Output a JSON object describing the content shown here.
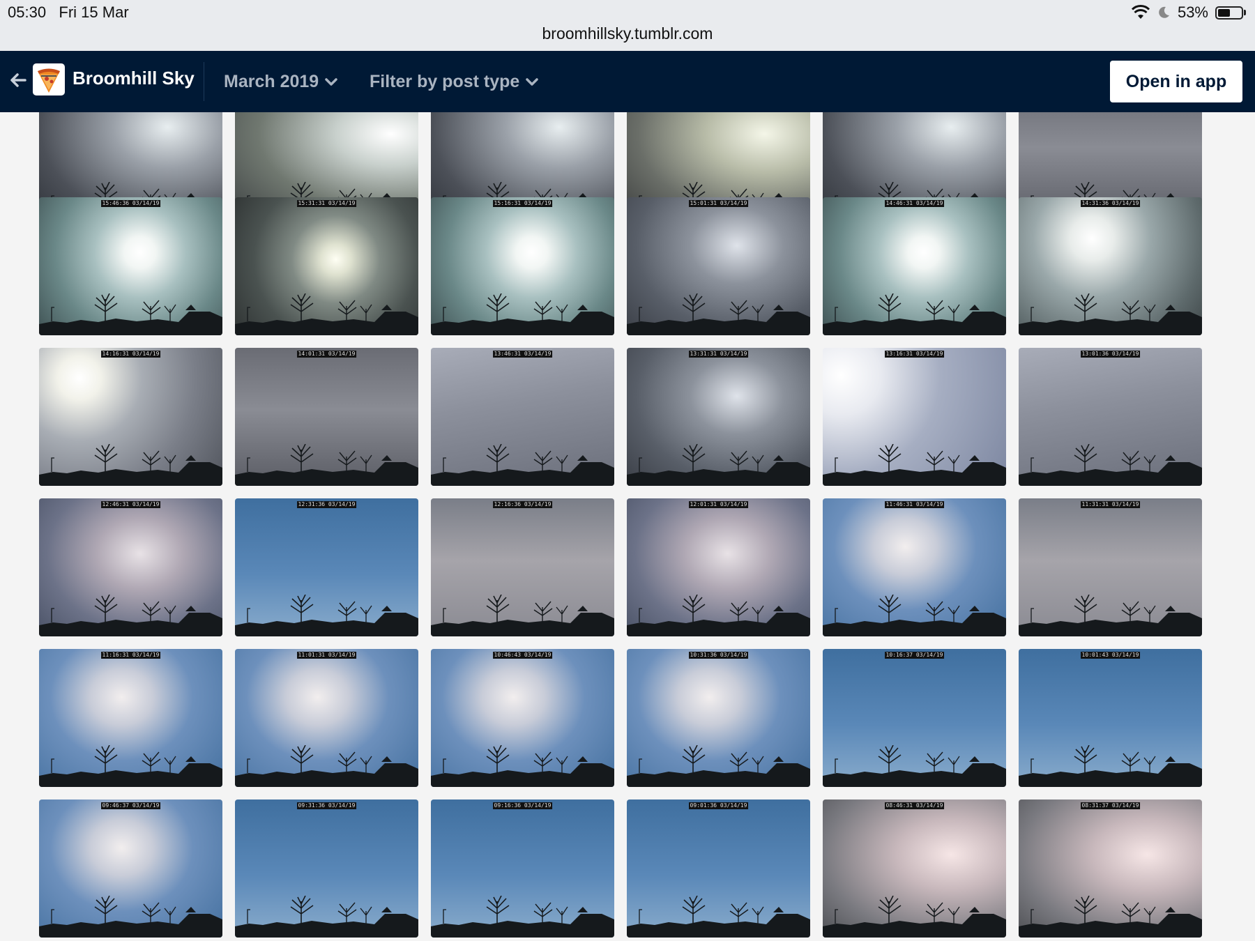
{
  "status_bar": {
    "time": "05:30",
    "date": "Fri 15 Mar",
    "battery": "53%",
    "battery_level": 0.53
  },
  "url_bar": {
    "url": "broomhillsky.tumblr.com"
  },
  "header": {
    "blog_name": "Broomhill Sky",
    "month_filter": "March 2019",
    "post_type_filter": "Filter by post type",
    "open_app_label": "Open in app"
  },
  "colors": {
    "header_bg": "#001935",
    "page_bg": "#f4f4f4"
  },
  "tiles": [
    {
      "stamp": "",
      "sky": "storm"
    },
    {
      "stamp": "",
      "sky": "bright-storm"
    },
    {
      "stamp": "",
      "sky": "storm"
    },
    {
      "stamp": "",
      "sky": "dusk"
    },
    {
      "stamp": "",
      "sky": "storm"
    },
    {
      "stamp": "",
      "sky": "grey"
    },
    {
      "stamp": "15:46:36 03/14/19",
      "sky": "sun-teal"
    },
    {
      "stamp": "15:31:31 03/14/19",
      "sky": "sun-dark"
    },
    {
      "stamp": "15:16:31 03/14/19",
      "sky": "sun-teal"
    },
    {
      "stamp": "15:01:31 03/14/19",
      "sky": "cloud-dark"
    },
    {
      "stamp": "14:46:31 03/14/19",
      "sky": "sun-teal"
    },
    {
      "stamp": "14:31:36 03/14/19",
      "sky": "sun-grey"
    },
    {
      "stamp": "14:16:31 03/14/19",
      "sky": "sun-left"
    },
    {
      "stamp": "14:01:31 03/14/19",
      "sky": "grey"
    },
    {
      "stamp": "13:46:31 03/14/19",
      "sky": "grey-light"
    },
    {
      "stamp": "13:31:31 03/14/19",
      "sky": "cloud-dark"
    },
    {
      "stamp": "13:16:31 03/14/19",
      "sky": "haze-left"
    },
    {
      "stamp": "13:01:36 03/14/19",
      "sky": "grey-light"
    },
    {
      "stamp": "12:46:31 03/14/19",
      "sky": "cumulus"
    },
    {
      "stamp": "12:31:36 03/14/19",
      "sky": "blue"
    },
    {
      "stamp": "12:16:36 03/14/19",
      "sky": "overcast"
    },
    {
      "stamp": "12:01:31 03/14/19",
      "sky": "cumulus"
    },
    {
      "stamp": "11:46:31 03/14/19",
      "sky": "blue-cloud"
    },
    {
      "stamp": "11:31:31 03/14/19",
      "sky": "overcast"
    },
    {
      "stamp": "11:16:31 03/14/19",
      "sky": "blue-cloud"
    },
    {
      "stamp": "11:01:31 03/14/19",
      "sky": "blue-cloud"
    },
    {
      "stamp": "10:46:43 03/14/19",
      "sky": "blue-cloud"
    },
    {
      "stamp": "10:31:36 03/14/19",
      "sky": "blue-cloud"
    },
    {
      "stamp": "10:16:37 03/14/19",
      "sky": "blue"
    },
    {
      "stamp": "10:01:43 03/14/19",
      "sky": "blue"
    },
    {
      "stamp": "09:46:37 03/14/19",
      "sky": "blue-cloud"
    },
    {
      "stamp": "09:31:36 03/14/19",
      "sky": "blue"
    },
    {
      "stamp": "09:16:36 03/14/19",
      "sky": "blue"
    },
    {
      "stamp": "09:01:36 03/14/19",
      "sky": "blue"
    },
    {
      "stamp": "08:46:31 03/14/19",
      "sky": "pink-haze"
    },
    {
      "stamp": "08:31:37 03/14/19",
      "sky": "pink-haze"
    }
  ]
}
